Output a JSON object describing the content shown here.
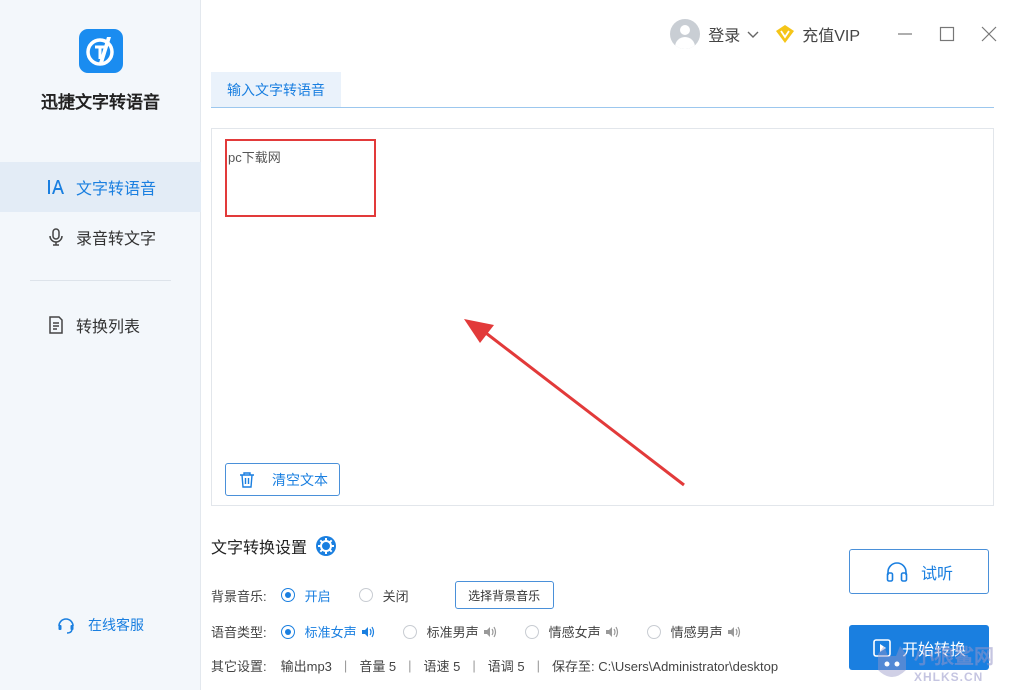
{
  "app": {
    "name": "迅捷文字转语音"
  },
  "sidebar": {
    "items": [
      {
        "label": "文字转语音",
        "icon": "text-a-icon",
        "active": true
      },
      {
        "label": "录音转文字",
        "icon": "microphone-icon",
        "active": false
      },
      {
        "label": "转换列表",
        "icon": "list-doc-icon",
        "active": false
      }
    ],
    "service_label": "在线客服"
  },
  "titlebar": {
    "login_label": "登录",
    "vip_label": "充值VIP"
  },
  "tabs": [
    {
      "label": "输入文字转语音"
    }
  ],
  "editor": {
    "text": "pc下载网",
    "clear_label": "清空文本"
  },
  "settings": {
    "title": "文字转换设置",
    "bgm": {
      "label": "背景音乐:",
      "on": "开启",
      "off": "关闭",
      "button": "选择背景音乐",
      "selected": "开启"
    },
    "voice": {
      "label": "语音类型:",
      "options": [
        "标准女声",
        "标准男声",
        "情感女声",
        "情感男声"
      ],
      "selected": "标准女声"
    },
    "other": {
      "label": "其它设置:",
      "format": "输出mp3",
      "volume": "音量 5",
      "speed": "语速 5",
      "pitch": "语调 5",
      "save": "保存至: C:\\Users\\Administrator\\desktop"
    }
  },
  "actions": {
    "listen_label": "试听",
    "start_label": "开始转换"
  },
  "watermark": {
    "line1": "小狼鲨网",
    "line2": "XHLKS.CN"
  },
  "colors": {
    "accent": "#1a7fe0",
    "highlight": "#e23a3a",
    "sidebar_bg": "#f3f7fb"
  }
}
